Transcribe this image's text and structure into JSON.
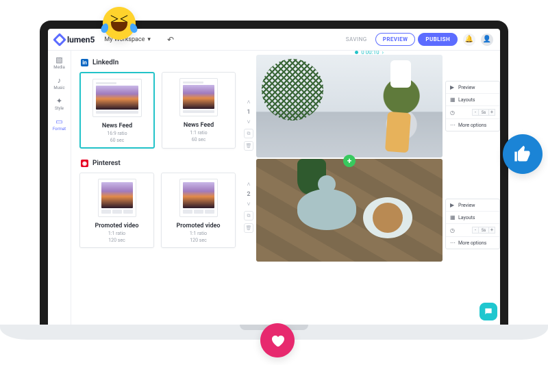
{
  "header": {
    "brand": "lumen5",
    "workspace": "My Workspace",
    "saving": "SAVING",
    "preview": "PREVIEW",
    "publish": "PUBLISH"
  },
  "rail": {
    "items": [
      {
        "label": "Media",
        "icon": "image-icon"
      },
      {
        "label": "Music",
        "icon": "music-icon"
      },
      {
        "label": "Style",
        "icon": "wand-icon"
      },
      {
        "label": "Format",
        "icon": "format-icon"
      }
    ]
  },
  "formats": {
    "sections": [
      {
        "network": "LinkedIn",
        "cards": [
          {
            "title": "News Feed",
            "ratio": "16:9 ratio",
            "duration": "60 sec",
            "selected": true
          },
          {
            "title": "News Feed",
            "ratio": "1:1 ratio",
            "duration": "60 sec",
            "selected": false
          }
        ]
      },
      {
        "network": "Pinterest",
        "cards": [
          {
            "title": "Promoted video",
            "ratio": "1:1 ratio",
            "duration": "120 sec",
            "selected": false
          },
          {
            "title": "Promoted video",
            "ratio": "1:1 ratio",
            "duration": "120 sec",
            "selected": false
          }
        ]
      }
    ]
  },
  "timeline": {
    "time": "0 00:10",
    "slides": [
      1,
      2
    ]
  },
  "controls": {
    "preview": "Preview",
    "layouts": "Layouts",
    "duration_value": "5s",
    "more": "More options"
  }
}
